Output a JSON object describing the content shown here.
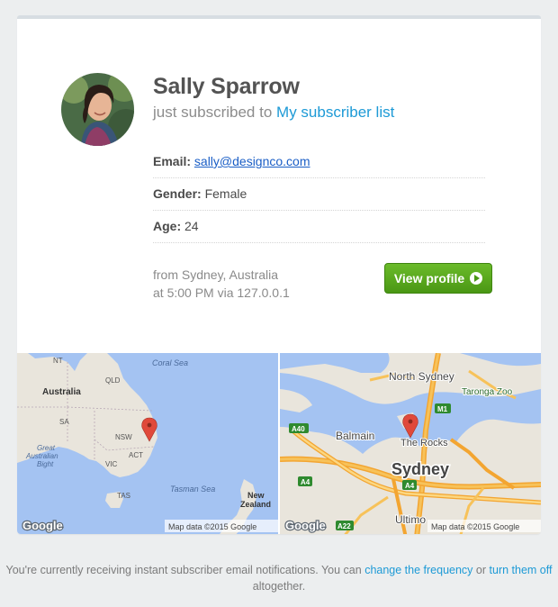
{
  "profile": {
    "name": "Sally Sparrow",
    "subscribed_prefix": "just subscribed to",
    "list_name": "My subscriber list",
    "email_label": "Email:",
    "email": "sally@designco.com",
    "gender_label": "Gender:",
    "gender": "Female",
    "age_label": "Age:",
    "age": "24",
    "location": "from Sydney, Australia",
    "time": "at 5:00 PM via 127.0.0.1",
    "button_label": "View profile"
  },
  "map_left": {
    "labels": {
      "nt": "NT",
      "qld": "QLD",
      "coral_sea": "Coral Sea",
      "australia": "Australia",
      "sa": "SA",
      "nsw": "NSW",
      "great_australian_bight": [
        "Great",
        "Australian",
        "Bight"
      ],
      "vic": "VIC",
      "act": "ACT",
      "tas": "TAS",
      "tasman_sea": "Tasman Sea",
      "new_zealand": [
        "New",
        "Zealand"
      ]
    },
    "google": "Google",
    "attribution": "Map data ©2015 Google"
  },
  "map_right": {
    "labels": {
      "north_sydney": "North Sydney",
      "taronga_zoo": "Taronga Zoo",
      "m1": "M1",
      "a40": "A40",
      "balmain": "Balmain",
      "the_rocks": "The Rocks",
      "sydney": "Sydney",
      "a4_left": "A4",
      "a4_mid": "A4",
      "ultimo": "Ultimo",
      "a22": "A22"
    },
    "google": "Google",
    "attribution": "Map data ©2015 Google"
  },
  "footer": {
    "text_before": "You're currently receiving instant subscriber email notifications. You can",
    "link_change": "change the frequency",
    "text_or": "or",
    "link_off": "turn them off",
    "text_after": "altogether."
  },
  "colors": {
    "accent": "#1d9ad6",
    "button_green": "#56a51d",
    "map_water": "#a4c3f2",
    "map_land": "#e9e5dc",
    "pin": "#e0493b"
  }
}
